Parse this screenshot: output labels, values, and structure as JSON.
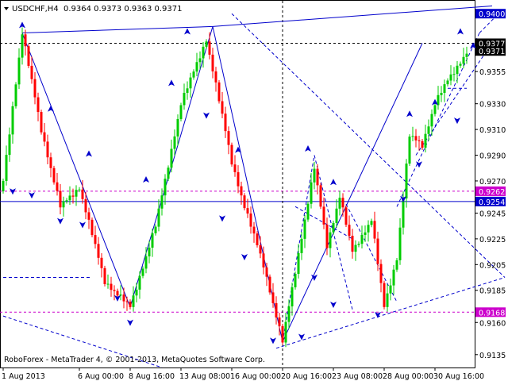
{
  "header": {
    "symbol_timeframe": "USDCHF,H4",
    "ohlc": "0.9364 0.9373 0.9363 0.9371",
    "menu_icon": "triangle-down-icon"
  },
  "footer": {
    "copyright": "RoboForex - MetaTrader 4, © 2001-2013, MetaQuotes Software Corp."
  },
  "colors": {
    "bull_candle": "#00cc00",
    "bear_candle": "#ff0000",
    "trend_line": "#0000cc",
    "magenta_line": "#cc00cc",
    "axis": "#000000"
  },
  "chart_data": {
    "type": "candlestick",
    "y_axis": {
      "position": "right",
      "range": [
        0.9125,
        0.941
      ],
      "ticks": [
        "0.9400",
        "0.9377",
        "0.9355",
        "0.9330",
        "0.9310",
        "0.9290",
        "0.9270",
        "0.9245",
        "0.9225",
        "0.9205",
        "0.9185",
        "0.9160",
        "0.9135"
      ]
    },
    "x_axis": {
      "labels": [
        "1 Aug 2013",
        "6 Aug 00:00",
        "8 Aug 16:00",
        "13 Aug 08:00",
        "16 Aug 00:00",
        "20 Aug 16:00",
        "23 Aug 08:00",
        "28 Aug 00:00",
        "30 Aug 16:00"
      ],
      "label_index": [
        0,
        24,
        40,
        56,
        72,
        88,
        104,
        120,
        136
      ]
    },
    "price_labels": [
      {
        "value": 0.94,
        "text": "0.9400",
        "style": "blue-box"
      },
      {
        "value": 0.9377,
        "text": "0.9377",
        "style": "black-box"
      },
      {
        "value": 0.9371,
        "text": "0.9371",
        "style": "black-box"
      },
      {
        "value": 0.9262,
        "text": "0.9262",
        "style": "magenta-box"
      },
      {
        "value": 0.9254,
        "text": "0.9254",
        "style": "blue-box"
      },
      {
        "value": 0.9168,
        "text": "0.9168",
        "style": "magenta-box"
      }
    ],
    "horizontal_lines": [
      {
        "value": 0.9377,
        "style": "dash",
        "color": "#000000"
      },
      {
        "value": 0.9262,
        "style": "dash",
        "color": "#cc00cc"
      },
      {
        "value": 0.9254,
        "style": "solid",
        "color": "#0000cc"
      },
      {
        "value": 0.9168,
        "style": "dash",
        "color": "#cc00cc"
      }
    ],
    "vertical_line": {
      "index": 88
    },
    "anchors": [
      [
        0,
        0.927
      ],
      [
        6,
        0.9385
      ],
      [
        12,
        0.931
      ],
      [
        18,
        0.925
      ],
      [
        24,
        0.9265
      ],
      [
        32,
        0.9192
      ],
      [
        40,
        0.9172
      ],
      [
        48,
        0.9235
      ],
      [
        56,
        0.933
      ],
      [
        64,
        0.938
      ],
      [
        72,
        0.9285
      ],
      [
        76,
        0.925
      ],
      [
        82,
        0.9205
      ],
      [
        88,
        0.9145
      ],
      [
        92,
        0.92
      ],
      [
        98,
        0.928
      ],
      [
        102,
        0.922
      ],
      [
        106,
        0.9258
      ],
      [
        110,
        0.9215
      ],
      [
        116,
        0.924
      ],
      [
        120,
        0.9172
      ],
      [
        124,
        0.921
      ],
      [
        128,
        0.9305
      ],
      [
        132,
        0.9298
      ],
      [
        136,
        0.933
      ],
      [
        140,
        0.9348
      ],
      [
        146,
        0.937
      ]
    ],
    "candle_count": 147,
    "candle_gap": 0.00022,
    "wick_ext": 0.00018,
    "trend_lines": [
      {
        "p1": [
          6,
          0.9385
        ],
        "p2": [
          66,
          0.939
        ],
        "style": "solid"
      },
      {
        "p1": [
          66,
          0.939
        ],
        "p2": [
          154,
          0.9406
        ],
        "style": "solid"
      },
      {
        "p1": [
          6,
          0.9385
        ],
        "p2": [
          40,
          0.9172
        ],
        "style": "solid"
      },
      {
        "p1": [
          40,
          0.9172
        ],
        "p2": [
          66,
          0.939
        ],
        "style": "solid"
      },
      {
        "p1": [
          66,
          0.939
        ],
        "p2": [
          88,
          0.9145
        ],
        "style": "solid"
      },
      {
        "p1": [
          88,
          0.9145
        ],
        "p2": [
          132,
          0.9377
        ],
        "style": "solid"
      },
      {
        "p1": [
          0,
          0.9195
        ],
        "p2": [
          28,
          0.9195
        ],
        "style": "dash"
      },
      {
        "p1": [
          0,
          0.9165
        ],
        "p2": [
          50,
          0.9125
        ],
        "style": "dash"
      },
      {
        "p1": [
          72,
          0.94
        ],
        "p2": [
          158,
          0.9195
        ],
        "style": "dash"
      },
      {
        "p1": [
          86,
          0.914
        ],
        "p2": [
          158,
          0.9195
        ],
        "style": "dash"
      },
      {
        "p1": [
          88,
          0.9145
        ],
        "p2": [
          98,
          0.929
        ],
        "style": "dash"
      },
      {
        "p1": [
          98,
          0.929
        ],
        "p2": [
          110,
          0.917
        ],
        "style": "dash"
      },
      {
        "p1": [
          92,
          0.925
        ],
        "p2": [
          110,
          0.9225
        ],
        "style": "dash"
      },
      {
        "p1": [
          108,
          0.9252
        ],
        "p2": [
          124,
          0.9176
        ],
        "style": "dash"
      },
      {
        "p1": [
          124,
          0.925
        ],
        "p2": [
          150,
          0.9385
        ],
        "style": "dash"
      },
      {
        "p1": [
          130,
          0.929
        ],
        "p2": [
          152,
          0.937
        ],
        "style": "dash"
      },
      {
        "p1": [
          140,
          0.9342
        ],
        "p2": [
          146,
          0.9342
        ],
        "style": "dash"
      },
      {
        "p1": [
          150,
          0.9385
        ],
        "p2": [
          156,
          0.94
        ],
        "style": "dash"
      }
    ],
    "fractal_markers": [
      {
        "index": 6,
        "value": 0.939,
        "dir": "up"
      },
      {
        "index": 15,
        "value": 0.9325,
        "dir": "up"
      },
      {
        "index": 27,
        "value": 0.929,
        "dir": "up"
      },
      {
        "index": 45,
        "value": 0.927,
        "dir": "up"
      },
      {
        "index": 53,
        "value": 0.9345,
        "dir": "up"
      },
      {
        "index": 58,
        "value": 0.9385,
        "dir": "up"
      },
      {
        "index": 74,
        "value": 0.9293,
        "dir": "up"
      },
      {
        "index": 96,
        "value": 0.9294,
        "dir": "up"
      },
      {
        "index": 104,
        "value": 0.9268,
        "dir": "up"
      },
      {
        "index": 128,
        "value": 0.9321,
        "dir": "up"
      },
      {
        "index": 136,
        "value": 0.933,
        "dir": "up"
      },
      {
        "index": 144,
        "value": 0.9385,
        "dir": "up"
      },
      {
        "index": 148,
        "value": 0.9374,
        "dir": "up"
      },
      {
        "index": 3,
        "value": 0.9263,
        "dir": "down"
      },
      {
        "index": 9,
        "value": 0.926,
        "dir": "down"
      },
      {
        "index": 18,
        "value": 0.924,
        "dir": "down"
      },
      {
        "index": 25,
        "value": 0.9237,
        "dir": "down"
      },
      {
        "index": 36,
        "value": 0.918,
        "dir": "down"
      },
      {
        "index": 40,
        "value": 0.9161,
        "dir": "down"
      },
      {
        "index": 64,
        "value": 0.9322,
        "dir": "down"
      },
      {
        "index": 69,
        "value": 0.9242,
        "dir": "down"
      },
      {
        "index": 76,
        "value": 0.9212,
        "dir": "down"
      },
      {
        "index": 85,
        "value": 0.9147,
        "dir": "down"
      },
      {
        "index": 94,
        "value": 0.915,
        "dir": "down"
      },
      {
        "index": 98,
        "value": 0.9196,
        "dir": "down"
      },
      {
        "index": 104,
        "value": 0.9175,
        "dir": "down"
      },
      {
        "index": 118,
        "value": 0.9167,
        "dir": "down"
      },
      {
        "index": 126,
        "value": 0.9257,
        "dir": "down"
      },
      {
        "index": 131,
        "value": 0.9284,
        "dir": "down"
      },
      {
        "index": 143,
        "value": 0.9318,
        "dir": "down"
      }
    ]
  }
}
